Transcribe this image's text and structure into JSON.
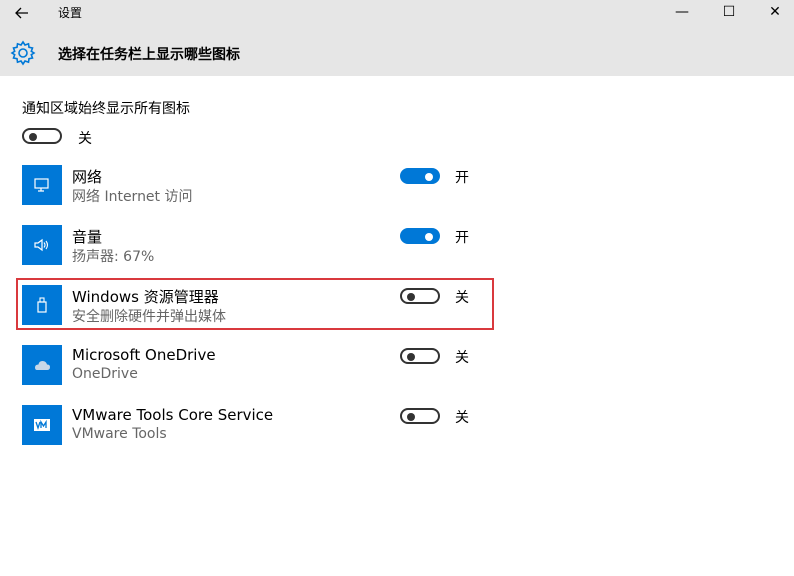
{
  "window": {
    "title": "设置",
    "back_icon": "arrow-left-icon",
    "minimize_glyph": "—",
    "maximize_glyph": "☐",
    "close_glyph": "✕"
  },
  "header": {
    "icon": "gear-icon",
    "title": "选择在任务栏上显示哪些图标"
  },
  "master": {
    "label": "通知区域始终显示所有图标",
    "state": "off",
    "state_label": "关"
  },
  "accent_color": "#0078d7",
  "highlight_color": "#d9393d",
  "apps": [
    {
      "name": "网络",
      "subtitle": "网络 Internet 访问",
      "icon": "network-icon",
      "state": "on",
      "state_label": "开"
    },
    {
      "name": "音量",
      "subtitle": "扬声器: 67%",
      "icon": "speaker-icon",
      "state": "on",
      "state_label": "开"
    },
    {
      "name": "Windows 资源管理器",
      "subtitle": "安全删除硬件并弹出媒体",
      "icon": "usb-drive-icon",
      "state": "off",
      "state_label": "关"
    },
    {
      "name": "Microsoft OneDrive",
      "subtitle": "OneDrive",
      "icon": "cloud-icon",
      "state": "off",
      "state_label": "关"
    },
    {
      "name": "VMware Tools Core Service",
      "subtitle": "VMware Tools",
      "icon": "vmware-icon",
      "state": "off",
      "state_label": "关"
    }
  ]
}
